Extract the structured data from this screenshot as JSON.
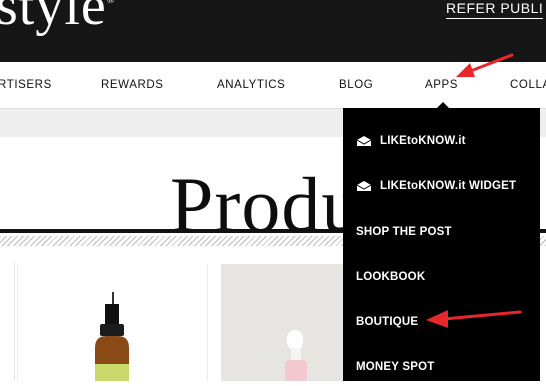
{
  "header": {
    "logo_text": "style",
    "logo_mark": "®",
    "refer_link": "REFER PUBLI"
  },
  "nav": {
    "items": [
      {
        "label": "RTISERS"
      },
      {
        "label": "REWARDS"
      },
      {
        "label": "ANALYTICS"
      },
      {
        "label": "BLOG"
      },
      {
        "label": "APPS"
      },
      {
        "label": "COLLA"
      }
    ]
  },
  "page": {
    "heading": "Produ"
  },
  "apps_menu": {
    "items": [
      {
        "label": "LIKEtoKNOW.it",
        "icon": "envelope-icon"
      },
      {
        "label": "LIKEtoKNOW.it WIDGET",
        "icon": "envelope-icon"
      },
      {
        "label": "SHOP THE POST"
      },
      {
        "label": "LOOKBOOK"
      },
      {
        "label": "BOUTIQUE"
      },
      {
        "label": "MONEY SPOT"
      }
    ]
  },
  "colors": {
    "header_bg": "#161616",
    "dropdown_bg": "#000000",
    "annotation_arrow": "#e8272c"
  }
}
